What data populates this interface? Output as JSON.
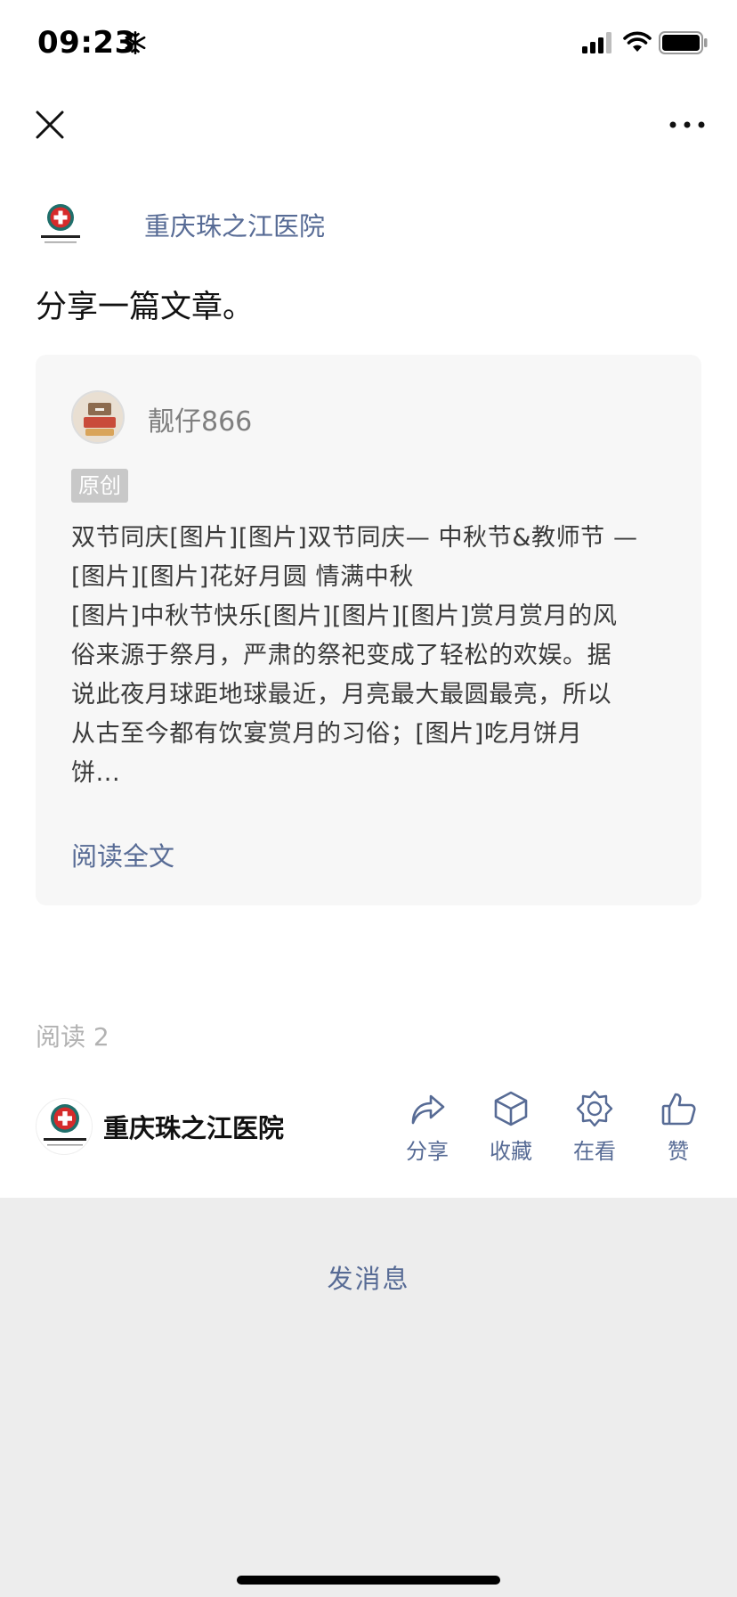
{
  "status_bar": {
    "time": "09:23",
    "icons": [
      "snowflake-icon",
      "signal-icon",
      "wifi-icon",
      "battery-icon"
    ]
  },
  "nav": {
    "icons": [
      "close-icon",
      "more-icon"
    ]
  },
  "account": {
    "name": "重庆珠之江医院",
    "logo_text": "重庆珠之江医院"
  },
  "post": {
    "text": "分享一篇文章。"
  },
  "card": {
    "author": "靓仔866",
    "badge": "原创",
    "excerpt_lines": [
      "双节同庆[图片][图片]双节同庆— 中秋节&教师节 —",
      "[图片][图片]花好月圆 情满中秋",
      "[图片]中秋节快乐[图片][图片][图片]赏月赏月的风",
      "俗来源于祭月，严肃的祭祀变成了轻松的欢娱。据",
      "说此夜月球距地球最近，月亮最大最圆最亮，所以",
      "从古至今都有饮宴赏月的习俗；[图片]吃月饼月",
      "饼..."
    ],
    "read_more": "阅读全文"
  },
  "read_count": "阅读 2",
  "footer": {
    "account_name": "重庆珠之江医院",
    "actions": [
      {
        "label": "分享",
        "icon": "share-icon"
      },
      {
        "label": "收藏",
        "icon": "favorite-icon"
      },
      {
        "label": "在看",
        "icon": "wow-icon"
      },
      {
        "label": "赞",
        "icon": "thumbs-up-icon"
      }
    ]
  },
  "bottom": {
    "send_message": "发消息"
  },
  "colors": {
    "link": "#576b95",
    "card_bg": "#f7f7f7",
    "bottom_bg": "#ededed",
    "logo_red": "#d62b2b",
    "logo_teal": "#1f6f6b"
  }
}
